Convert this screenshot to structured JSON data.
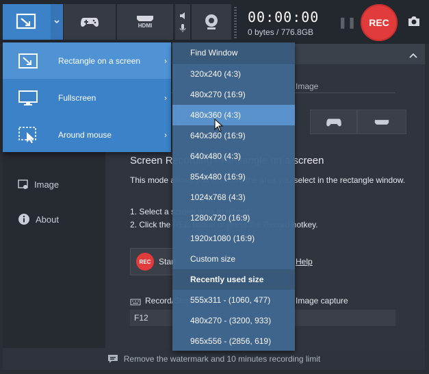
{
  "toolbar": {
    "timer": "00:00:00",
    "storage": "0 bytes / 776.8GB",
    "rec_label": "REC",
    "hdmi_label": "HDMI"
  },
  "sidebar": {
    "items": [
      {
        "label": "Image"
      },
      {
        "label": "About"
      }
    ]
  },
  "content": {
    "title": "Screen Recording - Rectangle on a screen",
    "description": "This mode allows you to record the area you select in the rectangle window.",
    "step1": "1. Select a screen area to record.",
    "step2": "2. Click the REC button or press the Record hotkey.",
    "start_label": "Start",
    "help_link": "Help",
    "record_hotkey_label": "Record/Stop hotkey",
    "image_capture_label": "Image capture",
    "hotkey_value": "F12",
    "image_tab": "Image"
  },
  "mode_menu": {
    "items": [
      {
        "label": "Rectangle on a screen",
        "icon": "rectangle-screen-icon"
      },
      {
        "label": "Fullscreen",
        "icon": "monitor-icon"
      },
      {
        "label": "Around mouse",
        "icon": "around-mouse-icon"
      }
    ]
  },
  "size_menu": {
    "find_window": "Find Window",
    "sizes": [
      "320x240 (4:3)",
      "480x270 (16:9)",
      "480x360 (4:3)",
      "640x360 (16:9)",
      "640x480 (4:3)",
      "854x480 (16:9)",
      "1024x768 (4:3)",
      "1280x720 (16:9)",
      "1920x1080 (16:9)"
    ],
    "custom_size": "Custom size",
    "recent_header": "Recently used size",
    "recent": [
      "555x311 - (1060, 477)",
      "480x270 - (3200, 933)",
      "965x556 - (2856, 619)"
    ],
    "highlighted": "480x360 (4:3)"
  },
  "footer": {
    "notice": "Remove the watermark and 10 minutes recording limit"
  },
  "colors": {
    "accent": "#3b82c8",
    "rec": "#e23b3b",
    "submenu": "#41678f",
    "highlight": "#5b94cf"
  }
}
